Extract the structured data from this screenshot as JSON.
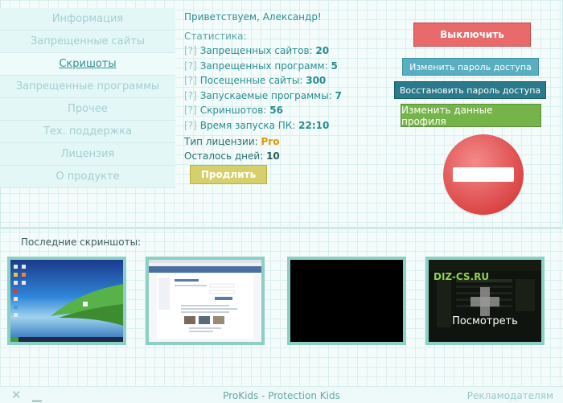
{
  "sidebar": {
    "items": [
      {
        "label": "Информация"
      },
      {
        "label": "Запрещенные сайты"
      },
      {
        "label": "Скришоты"
      },
      {
        "label": "Запрещенные программы"
      },
      {
        "label": "Прочее"
      },
      {
        "label": "Тех. поддержка"
      },
      {
        "label": "Лицензия"
      },
      {
        "label": "О продукте"
      }
    ]
  },
  "info": {
    "greeting": "Приветствуем, Александр!",
    "stats_title": "Статистика:",
    "q": "[?]",
    "stats": [
      {
        "label": "Запрещенных сайтов:",
        "value": "20"
      },
      {
        "label": "Запрещенных программ:",
        "value": "5"
      },
      {
        "label": "Посещенные сайты:",
        "value": "300"
      },
      {
        "label": "Запускаемые программы:",
        "value": "7"
      },
      {
        "label": "Скриншотов:",
        "value": "56"
      },
      {
        "label": "Время запуска ПК:",
        "value": "22:10"
      }
    ]
  },
  "license": {
    "type_label": "Тип лицензии:",
    "type_value": "Pro",
    "days_label": "Осталось дней:",
    "days_value": "10",
    "extend_label": "Продлить"
  },
  "actions": {
    "off_label": "Выключить",
    "change_password_label": "Изменить пароль доступа",
    "restore_password_label": "Восстановить пароль доступа",
    "change_profile_label": "Изменить данные профиля"
  },
  "screenshots": {
    "title": "Последние скриншоты:",
    "view_label": "Посмотреть",
    "site_logo": "DIZ-CS.RU"
  },
  "footer": {
    "title": "ProKids - Protection Kids",
    "ads": "Рекламодателям",
    "close": "✕",
    "minimize": "▁"
  },
  "colors": {
    "off": "#e86a6a",
    "change": "#5aaec1",
    "restore": "#2a7a8c",
    "profile": "#74b448",
    "extend": "#d6d06a",
    "stop": "#e55a5a"
  }
}
